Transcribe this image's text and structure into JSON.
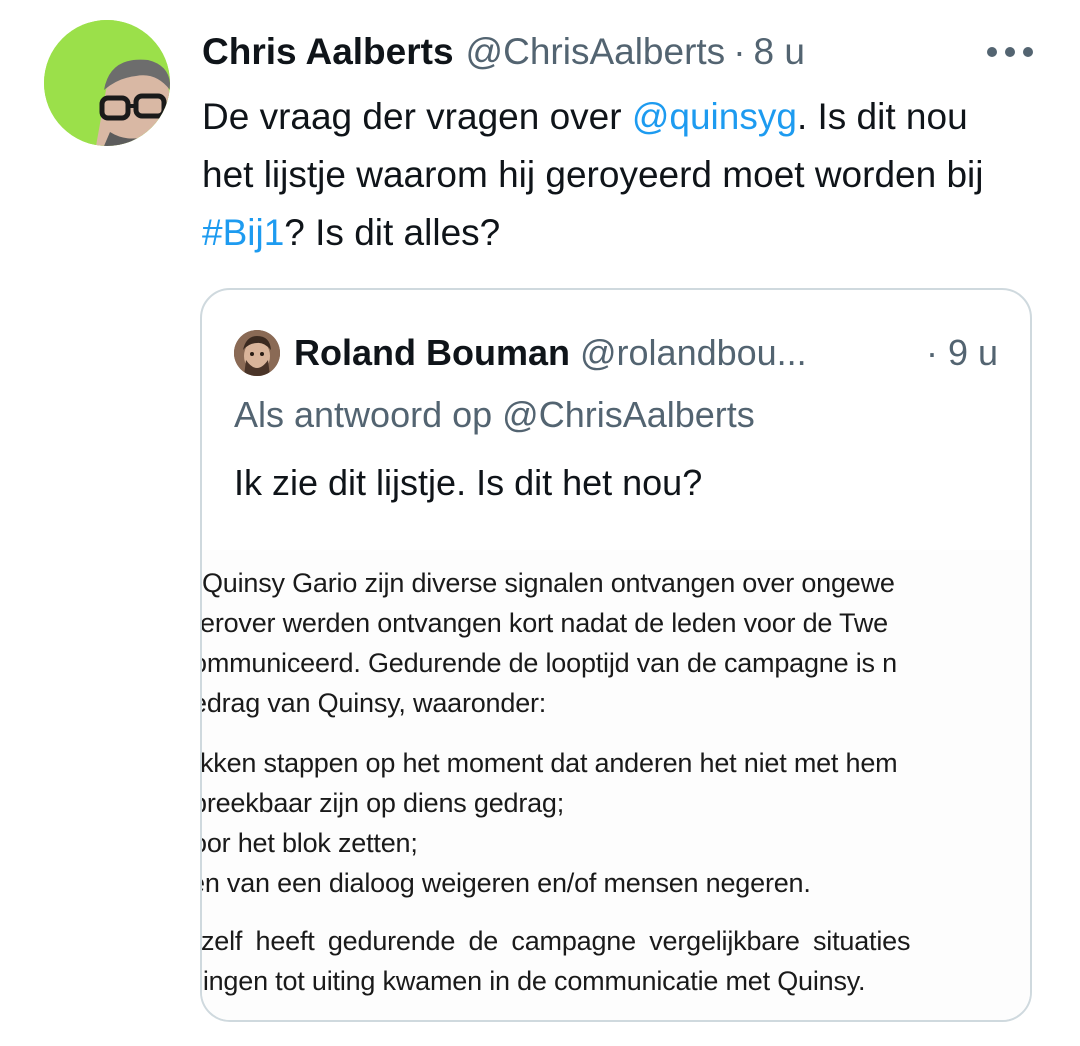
{
  "tweet": {
    "author_name": "Chris Aalberts",
    "author_handle": "@ChrisAalberts",
    "separator": "·",
    "time": "8 u",
    "more_icon": "more-horizontal-icon",
    "text_parts": {
      "p1": "De vraag der vragen over ",
      "mention": "@quinsyg",
      "p2": ". Is dit nou het lijstje waarom hij geroyeerd moet worden bij ",
      "hashtag": "#Bij1",
      "p3": "? Is dit alles?"
    }
  },
  "quote": {
    "author_name": "Roland Bouman",
    "author_handle": "@rolandbou...",
    "time": "· 9 u",
    "reply_context": "Als antwoord op @ChrisAalberts",
    "text": "Ik zie dit lijstje. Is dit het nou?",
    "media_lines": [
      "Quinsy Gario zijn diverse signalen ontvangen over ongewe",
      "erover werden ontvangen kort nadat de leden voor de Twe",
      "ommuniceerd. Gedurende de looptijd van de campagne is n",
      "edrag van Quinsy, waaronder:",
      "kken stappen op het moment dat anderen het niet met hem",
      "preekbaar zijn op diens gedrag;",
      "oor het blok zetten;",
      "en van een dialoog weigeren en/of mensen negeren.",
      "zelf heeft gedurende de campagne vergelijkbare situaties",
      "ningen tot uiting kwamen in de communicatie met Quinsy."
    ]
  },
  "colors": {
    "text": "#0f1419",
    "secondary": "#536471",
    "link": "#1d9bf0",
    "border": "#cfd9de"
  }
}
